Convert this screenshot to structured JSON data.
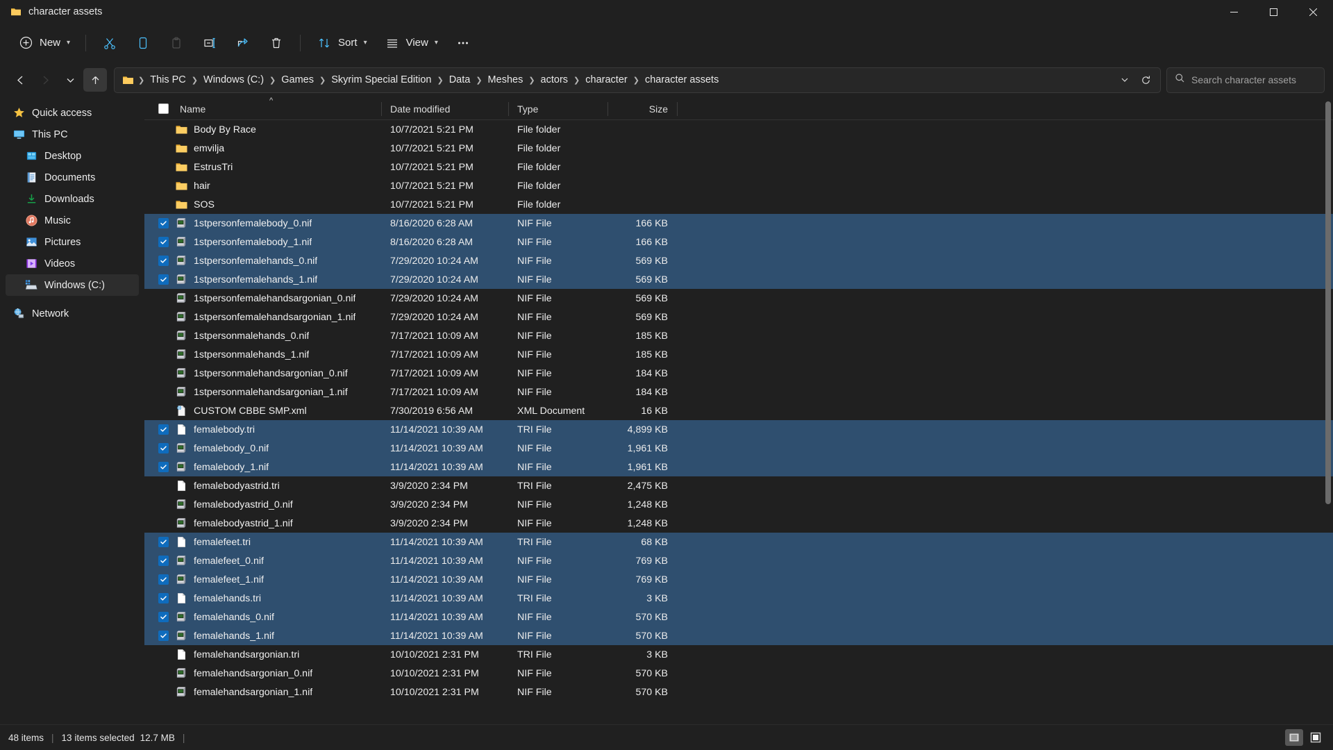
{
  "window": {
    "tab_title": "character assets",
    "minimize": "Minimize",
    "maximize": "Maximize",
    "close": "Close"
  },
  "toolbar": {
    "new_label": "New",
    "cut_label": "Cut",
    "copy_label": "Copy",
    "paste_label": "Paste",
    "rename_label": "Rename",
    "share_label": "Share",
    "delete_label": "Delete",
    "sort_label": "Sort",
    "view_label": "View",
    "more_label": "See more"
  },
  "nav": {
    "back_label": "Back",
    "forward_label": "Forward",
    "recent_label": "Recent locations",
    "up_label": "Up to character",
    "refresh_label": "Refresh",
    "breadcrumbs": [
      "This PC",
      "Windows (C:)",
      "Games",
      "Skyrim Special Edition",
      "Data",
      "Meshes",
      "actors",
      "character",
      "character assets"
    ]
  },
  "search": {
    "placeholder": "Search character assets"
  },
  "sidebar": {
    "items": [
      {
        "label": "Quick access",
        "icon": "star-icon",
        "indent": false,
        "selected": false
      },
      {
        "label": "This PC",
        "icon": "monitor-icon",
        "indent": false,
        "selected": false
      },
      {
        "label": "Desktop",
        "icon": "desktop-icon",
        "indent": true,
        "selected": false
      },
      {
        "label": "Documents",
        "icon": "documents-icon",
        "indent": true,
        "selected": false
      },
      {
        "label": "Downloads",
        "icon": "downloads-icon",
        "indent": true,
        "selected": false
      },
      {
        "label": "Music",
        "icon": "music-icon",
        "indent": true,
        "selected": false
      },
      {
        "label": "Pictures",
        "icon": "pictures-icon",
        "indent": true,
        "selected": false
      },
      {
        "label": "Videos",
        "icon": "videos-icon",
        "indent": true,
        "selected": false
      },
      {
        "label": "Windows (C:)",
        "icon": "drive-icon",
        "indent": true,
        "selected": true
      },
      {
        "label": "Network",
        "icon": "network-icon",
        "indent": false,
        "selected": false
      }
    ]
  },
  "columns": {
    "name": "Name",
    "date_modified": "Date modified",
    "type": "Type",
    "size": "Size",
    "sort_direction": "ascending"
  },
  "files": [
    {
      "name": "Body By Race",
      "date": "10/7/2021 5:21 PM",
      "type": "File folder",
      "size": "",
      "icon": "folder-icon",
      "selected": false
    },
    {
      "name": "emvilja",
      "date": "10/7/2021 5:21 PM",
      "type": "File folder",
      "size": "",
      "icon": "folder-icon",
      "selected": false
    },
    {
      "name": "EstrusTri",
      "date": "10/7/2021 5:21 PM",
      "type": "File folder",
      "size": "",
      "icon": "folder-icon",
      "selected": false
    },
    {
      "name": "hair",
      "date": "10/7/2021 5:21 PM",
      "type": "File folder",
      "size": "",
      "icon": "folder-icon",
      "selected": false
    },
    {
      "name": "SOS",
      "date": "10/7/2021 5:21 PM",
      "type": "File folder",
      "size": "",
      "icon": "folder-icon",
      "selected": false
    },
    {
      "name": "1stpersonfemalebody_0.nif",
      "date": "8/16/2020 6:28 AM",
      "type": "NIF File",
      "size": "166 KB",
      "icon": "nif-icon",
      "selected": true
    },
    {
      "name": "1stpersonfemalebody_1.nif",
      "date": "8/16/2020 6:28 AM",
      "type": "NIF File",
      "size": "166 KB",
      "icon": "nif-icon",
      "selected": true
    },
    {
      "name": "1stpersonfemalehands_0.nif",
      "date": "7/29/2020 10:24 AM",
      "type": "NIF File",
      "size": "569 KB",
      "icon": "nif-icon",
      "selected": true
    },
    {
      "name": "1stpersonfemalehands_1.nif",
      "date": "7/29/2020 10:24 AM",
      "type": "NIF File",
      "size": "569 KB",
      "icon": "nif-icon",
      "selected": true
    },
    {
      "name": "1stpersonfemalehandsargonian_0.nif",
      "date": "7/29/2020 10:24 AM",
      "type": "NIF File",
      "size": "569 KB",
      "icon": "nif-icon",
      "selected": false
    },
    {
      "name": "1stpersonfemalehandsargonian_1.nif",
      "date": "7/29/2020 10:24 AM",
      "type": "NIF File",
      "size": "569 KB",
      "icon": "nif-icon",
      "selected": false
    },
    {
      "name": "1stpersonmalehands_0.nif",
      "date": "7/17/2021 10:09 AM",
      "type": "NIF File",
      "size": "185 KB",
      "icon": "nif-icon",
      "selected": false
    },
    {
      "name": "1stpersonmalehands_1.nif",
      "date": "7/17/2021 10:09 AM",
      "type": "NIF File",
      "size": "185 KB",
      "icon": "nif-icon",
      "selected": false
    },
    {
      "name": "1stpersonmalehandsargonian_0.nif",
      "date": "7/17/2021 10:09 AM",
      "type": "NIF File",
      "size": "184 KB",
      "icon": "nif-icon",
      "selected": false
    },
    {
      "name": "1stpersonmalehandsargonian_1.nif",
      "date": "7/17/2021 10:09 AM",
      "type": "NIF File",
      "size": "184 KB",
      "icon": "nif-icon",
      "selected": false
    },
    {
      "name": "CUSTOM CBBE SMP.xml",
      "date": "7/30/2019 6:56 AM",
      "type": "XML Document",
      "size": "16 KB",
      "icon": "xml-icon",
      "selected": false
    },
    {
      "name": "femalebody.tri",
      "date": "11/14/2021 10:39 AM",
      "type": "TRI File",
      "size": "4,899 KB",
      "icon": "tri-icon",
      "selected": true
    },
    {
      "name": "femalebody_0.nif",
      "date": "11/14/2021 10:39 AM",
      "type": "NIF File",
      "size": "1,961 KB",
      "icon": "nif-icon",
      "selected": true
    },
    {
      "name": "femalebody_1.nif",
      "date": "11/14/2021 10:39 AM",
      "type": "NIF File",
      "size": "1,961 KB",
      "icon": "nif-icon",
      "selected": true
    },
    {
      "name": "femalebodyastrid.tri",
      "date": "3/9/2020 2:34 PM",
      "type": "TRI File",
      "size": "2,475 KB",
      "icon": "tri-icon",
      "selected": false
    },
    {
      "name": "femalebodyastrid_0.nif",
      "date": "3/9/2020 2:34 PM",
      "type": "NIF File",
      "size": "1,248 KB",
      "icon": "nif-icon",
      "selected": false
    },
    {
      "name": "femalebodyastrid_1.nif",
      "date": "3/9/2020 2:34 PM",
      "type": "NIF File",
      "size": "1,248 KB",
      "icon": "nif-icon",
      "selected": false
    },
    {
      "name": "femalefeet.tri",
      "date": "11/14/2021 10:39 AM",
      "type": "TRI File",
      "size": "68 KB",
      "icon": "tri-icon",
      "selected": true
    },
    {
      "name": "femalefeet_0.nif",
      "date": "11/14/2021 10:39 AM",
      "type": "NIF File",
      "size": "769 KB",
      "icon": "nif-icon",
      "selected": true
    },
    {
      "name": "femalefeet_1.nif",
      "date": "11/14/2021 10:39 AM",
      "type": "NIF File",
      "size": "769 KB",
      "icon": "nif-icon",
      "selected": true
    },
    {
      "name": "femalehands.tri",
      "date": "11/14/2021 10:39 AM",
      "type": "TRI File",
      "size": "3 KB",
      "icon": "tri-icon",
      "selected": true
    },
    {
      "name": "femalehands_0.nif",
      "date": "11/14/2021 10:39 AM",
      "type": "NIF File",
      "size": "570 KB",
      "icon": "nif-icon",
      "selected": true
    },
    {
      "name": "femalehands_1.nif",
      "date": "11/14/2021 10:39 AM",
      "type": "NIF File",
      "size": "570 KB",
      "icon": "nif-icon",
      "selected": true
    },
    {
      "name": "femalehandsargonian.tri",
      "date": "10/10/2021 2:31 PM",
      "type": "TRI File",
      "size": "3 KB",
      "icon": "tri-icon",
      "selected": false
    },
    {
      "name": "femalehandsargonian_0.nif",
      "date": "10/10/2021 2:31 PM",
      "type": "NIF File",
      "size": "570 KB",
      "icon": "nif-icon",
      "selected": false
    },
    {
      "name": "femalehandsargonian_1.nif",
      "date": "10/10/2021 2:31 PM",
      "type": "NIF File",
      "size": "570 KB",
      "icon": "nif-icon",
      "selected": false
    }
  ],
  "status": {
    "item_count": "48 items",
    "selection": "13 items selected",
    "selection_size": "12.7 MB",
    "details_view_label": "Details view",
    "icons_view_label": "Large icons view"
  },
  "colors": {
    "accent": "#0f6cbd",
    "selection_row": "#2f4f6f",
    "folder": "#f5c469",
    "background": "#202020"
  }
}
